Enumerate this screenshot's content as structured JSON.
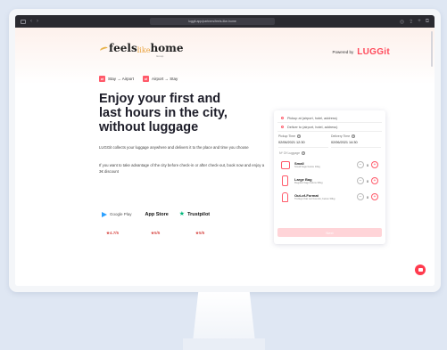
{
  "browser": {
    "url": "luggit.app/partners/feels-like-home"
  },
  "header": {
    "logo_main": "feels",
    "logo_like": "like",
    "logo_home": "home",
    "logo_sub": "Group",
    "powered_label": "Powered by",
    "powered_brand": "LUGGit"
  },
  "toggle": {
    "option1": "Stay → Airport",
    "option2": "Airport → Stay"
  },
  "hero": {
    "headline": "Enjoy your first and last hours in the city, without luggage",
    "paragraph1": "LUGGit collects your luggage anywhere and delivers it to the place and time you choose",
    "paragraph2": "If you want to take advantage of the city before check-in or after check-out, book now and enjoy a 3€ discount"
  },
  "badges": {
    "google": "Google Play",
    "apple": "App Store",
    "trust": "Trustpilot",
    "rating_google": "★4.7/5",
    "rating_apple": "★5/5",
    "rating_trust": "★5/5"
  },
  "booking": {
    "pickup_placeholder": "Pickup at (airport, hotel, address)",
    "deliver_placeholder": "Deliver to (airport, hotel, address)",
    "pickup_time_label": "Pickup Time",
    "delivery_time_label": "Delivery Time",
    "pickup_time": "02/06/2021 12:30",
    "delivery_time": "02/06/2021 14:30",
    "luggage_title": "Nº Of Luggage",
    "items": [
      {
        "name": "Small",
        "desc": "Small bags below 10kg",
        "count": "0"
      },
      {
        "name": "Large Bag",
        "desc": "Regular bags below 30kg",
        "count": "0"
      },
      {
        "name": "Out-of-Format",
        "desc": "Trolleys that out bounds, below 30kg",
        "count": "0"
      }
    ],
    "next_label": "Next"
  },
  "colors": {
    "accent": "#ff4b5c",
    "brand_gold": "#e8a03a"
  }
}
